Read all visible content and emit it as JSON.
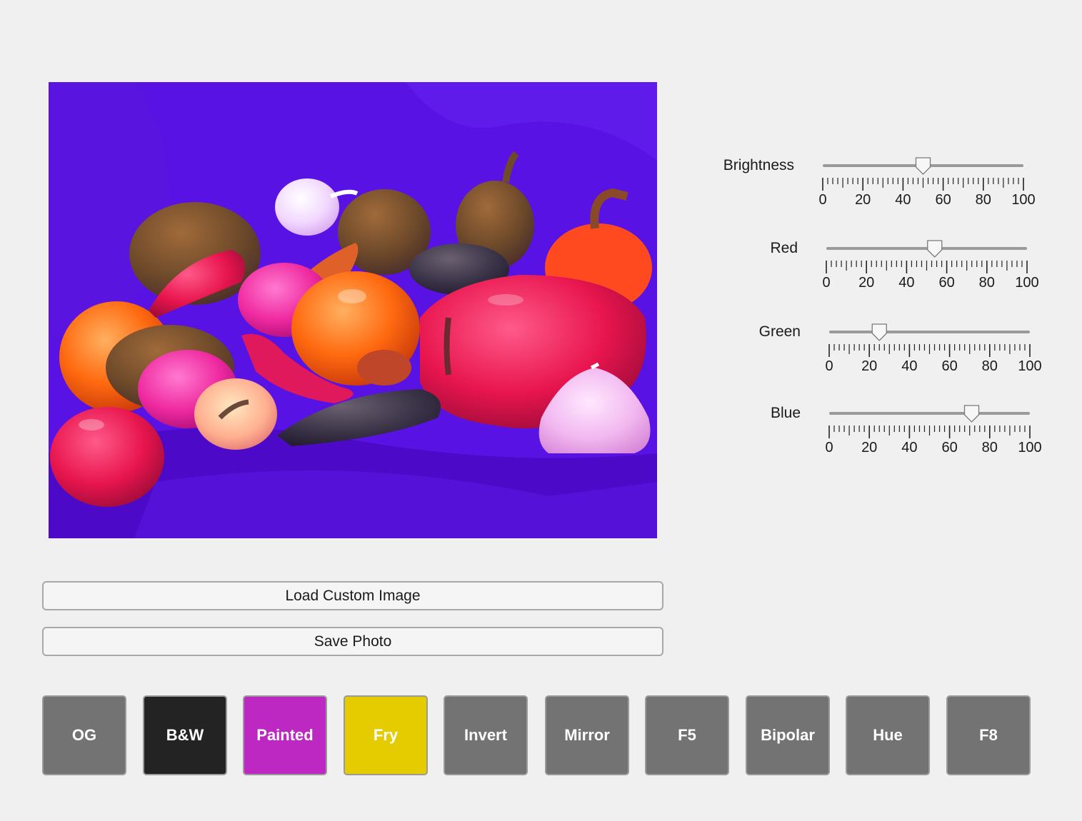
{
  "image": {
    "description_icon": "image-display"
  },
  "sliders": [
    {
      "label": "Brightness",
      "value": 50,
      "min": 0,
      "max": 100,
      "ticks": [
        "0",
        "20",
        "40",
        "60",
        "80",
        "100"
      ]
    },
    {
      "label": "Red",
      "value": 54,
      "min": 0,
      "max": 100,
      "ticks": [
        "0",
        "20",
        "40",
        "60",
        "80",
        "100"
      ]
    },
    {
      "label": "Green",
      "value": 25,
      "min": 0,
      "max": 100,
      "ticks": [
        "0",
        "20",
        "40",
        "60",
        "80",
        "100"
      ]
    },
    {
      "label": "Blue",
      "value": 71,
      "min": 0,
      "max": 100,
      "ticks": [
        "0",
        "20",
        "40",
        "60",
        "80",
        "100"
      ]
    }
  ],
  "buttons": {
    "load_label": "Load Custom Image",
    "save_label": "Save Photo"
  },
  "filters": [
    {
      "label": "OG",
      "color": "#737373",
      "text_color": "#ffffff"
    },
    {
      "label": "B&W",
      "color": "#232323",
      "text_color": "#ffffff"
    },
    {
      "label": "Painted",
      "color": "#bd28c2",
      "text_color": "#ffffff"
    },
    {
      "label": "Fry",
      "color": "#e4cc00",
      "text_color": "#ffffff"
    },
    {
      "label": "Invert",
      "color": "#737373",
      "text_color": "#ffffff"
    },
    {
      "label": "Mirror",
      "color": "#737373",
      "text_color": "#ffffff"
    },
    {
      "label": "F5",
      "color": "#737373",
      "text_color": "#ffffff"
    },
    {
      "label": "Bipolar",
      "color": "#737373",
      "text_color": "#ffffff"
    },
    {
      "label": "Hue",
      "color": "#737373",
      "text_color": "#ffffff"
    },
    {
      "label": "F8",
      "color": "#737373",
      "text_color": "#ffffff"
    }
  ]
}
